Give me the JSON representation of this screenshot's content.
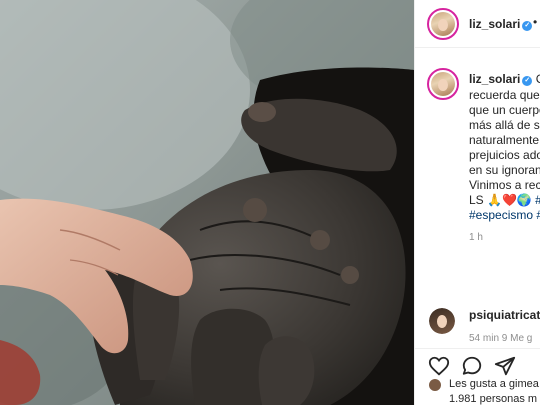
{
  "header": {
    "username": "liz_solari",
    "verified_glyph": "✓",
    "more_glyph": "•"
  },
  "caption": {
    "username": "liz_solari",
    "verified_glyph": "✓",
    "lines": [
      "C",
      "recuerda que",
      "que un cuerpo",
      "más allá de su",
      "naturalmente",
      "prejuicios ado",
      "en su ignoran",
      "Vinimos a rec"
    ],
    "line9_prefix": "LS ",
    "line9_emoji": "🙏❤️🌍",
    "line9_tag": " #he",
    "line10_tag": "#especismo #",
    "time": "1 h"
  },
  "comment": {
    "username": "psiquiatricat",
    "meta": "54 min   9 Me g"
  },
  "likes": {
    "line1": "Les gusta a gimea",
    "line2": "1.981 personas m"
  },
  "icons": {
    "like": "heart-icon",
    "comment": "comment-icon",
    "share": "share-icon"
  },
  "colors": {
    "link": "#00376b",
    "verified": "#3897f0",
    "muted": "#8e8e8e",
    "ring": "#d6249f"
  }
}
